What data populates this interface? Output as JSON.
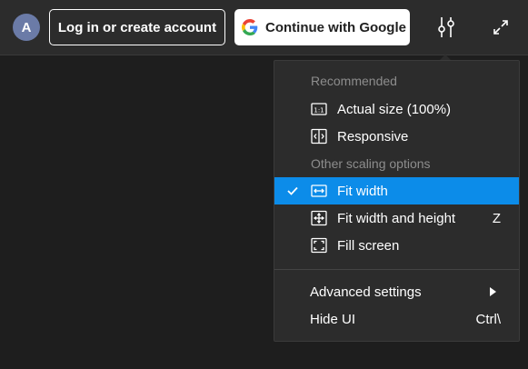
{
  "topbar": {
    "avatar_letter": "A",
    "login_label": "Log in or create account",
    "google_label": "Continue with Google"
  },
  "menu": {
    "header_recommended": "Recommended",
    "header_other": "Other scaling options",
    "items": [
      {
        "label": "Actual size (100%)",
        "icon": "actual-size-icon"
      },
      {
        "label": "Responsive",
        "icon": "responsive-icon"
      },
      {
        "label": "Fit width",
        "icon": "fit-width-icon",
        "selected": true
      },
      {
        "label": "Fit width and height",
        "icon": "fit-width-height-icon",
        "shortcut": "Z"
      },
      {
        "label": "Fill screen",
        "icon": "fill-screen-icon"
      }
    ],
    "advanced_label": "Advanced settings",
    "hide_ui_label": "Hide UI",
    "hide_ui_shortcut": "Ctrl\\"
  },
  "colors": {
    "accent": "#0c8ce9",
    "background": "#1e1e1e",
    "panel": "#2c2c2c"
  }
}
